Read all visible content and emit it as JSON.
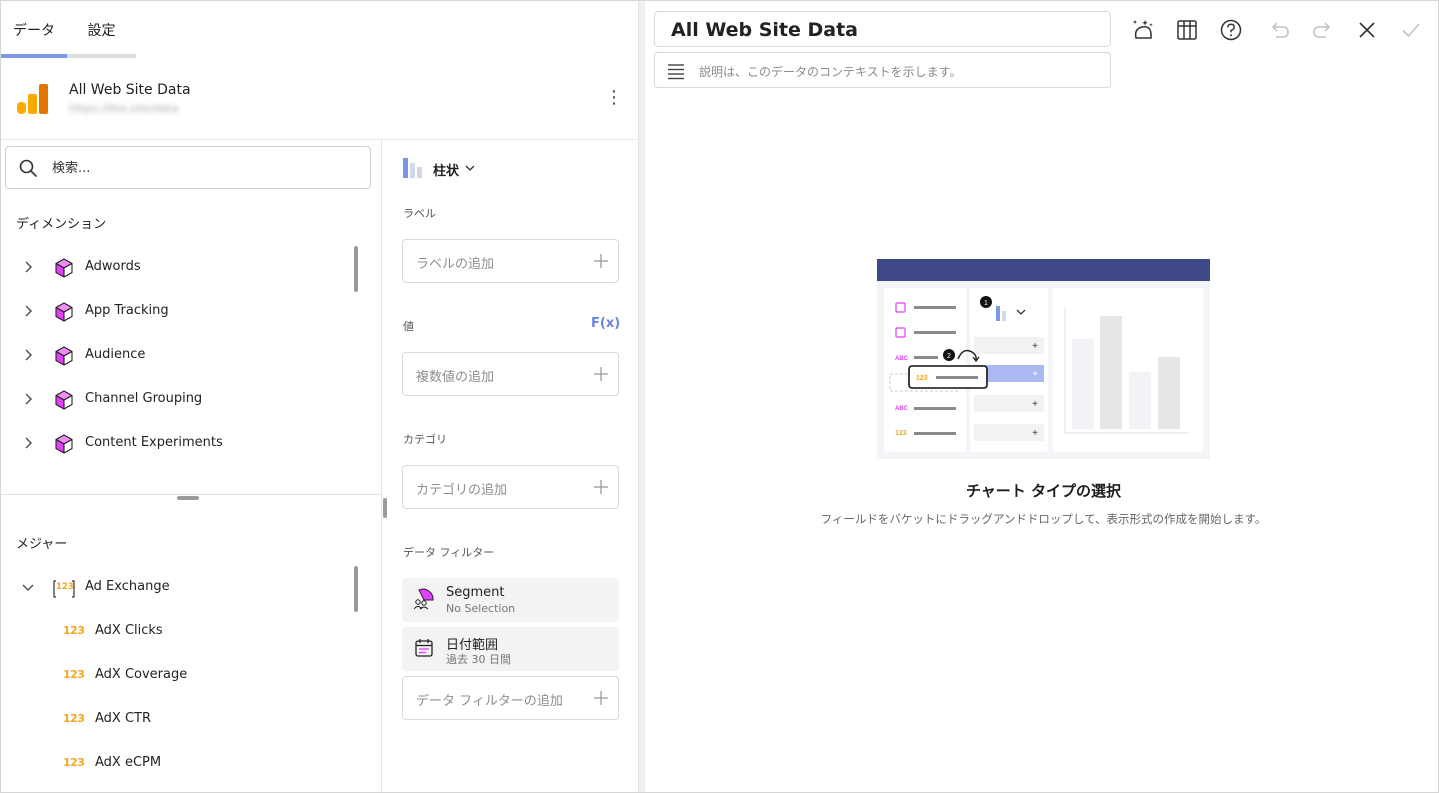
{
  "tabs": [
    {
      "label": "データ"
    },
    {
      "label": "設定"
    }
  ],
  "datasource": {
    "title": "All Web Site Data",
    "subtitle": "https://the.site/data"
  },
  "search": {
    "placeholder": "検索..."
  },
  "dimensions": {
    "heading": "ディメンション",
    "items": [
      {
        "label": "Adwords"
      },
      {
        "label": "App Tracking"
      },
      {
        "label": "Audience"
      },
      {
        "label": "Channel Grouping"
      },
      {
        "label": "Content Experiments"
      }
    ]
  },
  "measures": {
    "heading": "メジャー",
    "group": {
      "label": "Ad Exchange",
      "icon": "123"
    },
    "items": [
      {
        "icon": "123",
        "label": "AdX Clicks"
      },
      {
        "icon": "123",
        "label": "AdX Coverage"
      },
      {
        "icon": "123",
        "label": "AdX CTR"
      },
      {
        "icon": "123",
        "label": "AdX eCPM"
      }
    ]
  },
  "config": {
    "chart_type": "柱状",
    "labels": {
      "heading": "ラベル",
      "placeholder": "ラベルの追加"
    },
    "values": {
      "heading": "値",
      "fx": "F(x)",
      "placeholder": "複数値の追加"
    },
    "category": {
      "heading": "カテゴリ",
      "placeholder": "カテゴリの追加"
    },
    "filters": {
      "heading": "データ フィルター",
      "items": [
        {
          "title": "Segment",
          "sub": "No Selection"
        },
        {
          "title": "日付範囲",
          "sub": "過去 30 日間"
        }
      ],
      "placeholder": "データ フィルターの追加"
    }
  },
  "editor": {
    "title": "All Web Site Data",
    "description_placeholder": "説明は、このデータのコンテキストを示します。"
  },
  "empty_state": {
    "title": "チャート タイプの選択",
    "subtitle": "フィールドをバケットにドラッグアンドドロップして、表示形式の作成を開始します。",
    "ill_badge_1": "1",
    "ill_badge_2": "2",
    "ill_abc": "ABC",
    "ill_123": "123"
  },
  "colors": {
    "accent": "#7d96e8",
    "cube": "#e040fb",
    "number": "#f5a623",
    "header_bar": "#3f4889"
  }
}
